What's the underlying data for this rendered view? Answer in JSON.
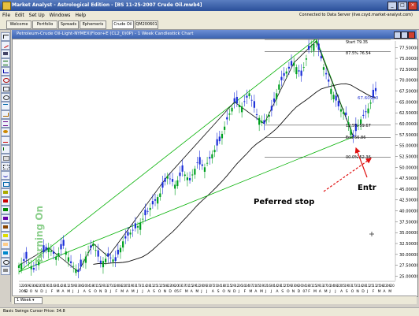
{
  "window": {
    "title": "Market Analyst - Astrological Edition - [BS 11-25-2007 Crude Oil.mwb4]"
  },
  "menu": [
    {
      "label": "File"
    },
    {
      "label": "Edit"
    },
    {
      "label": "Set Up"
    },
    {
      "label": "Windows"
    },
    {
      "label": "Help"
    }
  ],
  "connection": {
    "status": "Connected to Data Server (live.csyd.market-analyst.com)"
  },
  "tabs": [
    {
      "label": "Welcome"
    },
    {
      "label": "Portfolio"
    },
    {
      "label": "Spreads"
    },
    {
      "label": "Ephemeris"
    },
    {
      "label": "Crude Oil"
    },
    {
      "label": "QM200601"
    }
  ],
  "chart_window": {
    "title": "Petroleum-Crude Oil-Light-NYMEX(Floor+E (CL2_0)0P) - 1 Week Candlestick Chart"
  },
  "chart": {
    "annotations": {
      "side_label": "Turning On",
      "stop_label": "Peferred stop",
      "entry_label": "Entr",
      "last_price": "67.60900"
    },
    "fib_labels": {
      "start": "Start 79.35",
      "f875": "87.5% 76.54",
      "f125": "12.5% 59.67",
      "end": "End 56.86",
      "f00": "00.0% 52.36"
    },
    "colors": {
      "up": "#00a020",
      "down": "#1a2ed8",
      "fan": "#00b000",
      "stop": "#e01010"
    }
  },
  "chart_data": {
    "type": "candlestick",
    "y_ticks": [
      "77.50000",
      "75.00000",
      "72.50000",
      "70.00000",
      "67.50000",
      "65.00000",
      "62.50000",
      "60.00000",
      "57.50000",
      "55.00000",
      "52.50000",
      "50.00000",
      "47.50000",
      "45.00000",
      "42.50000",
      "40.00000",
      "37.50000",
      "35.00000",
      "32.50000",
      "30.00000",
      "27.50000",
      "25.00000"
    ],
    "y_values": [
      77.5,
      75,
      72.5,
      70,
      67.5,
      65,
      62.5,
      60,
      57.5,
      55,
      52.5,
      50,
      47.5,
      45,
      42.5,
      40,
      37.5,
      35,
      32.5,
      30,
      27.5,
      25
    ],
    "x_day_labels": [
      "12",
      "26",
      "09",
      "23",
      "08",
      "22",
      "05",
      "19",
      "02",
      "16",
      "30",
      "14",
      "28",
      "11",
      "25",
      "09",
      "23",
      "06",
      "20",
      "04",
      "18",
      "01",
      "15",
      "29",
      "13",
      "27",
      "10",
      "24",
      "08",
      "22",
      "05",
      "19",
      "03",
      "17",
      "31",
      "14",
      "28",
      "11",
      "25",
      "11",
      "25",
      "08",
      "22",
      "06",
      "20",
      "03",
      "17",
      "01",
      "15",
      "29",
      "12",
      "26",
      "09",
      "23",
      "07",
      "21",
      "04",
      "18",
      "01",
      "15",
      "29",
      "12",
      "26",
      "10",
      "24",
      "07",
      "21",
      "05",
      "19",
      "02",
      "16",
      "30",
      "14",
      "28",
      "11",
      "25",
      "09",
      "23",
      "06",
      "20",
      "04",
      "18",
      "01",
      "15",
      "29",
      "13",
      "27",
      "10",
      "24",
      "08",
      "22",
      "05",
      "19",
      "03",
      "17",
      "31",
      "14",
      "28",
      "11",
      "25",
      "11",
      "25",
      "08",
      "22",
      "06",
      "20"
    ],
    "x_month_labels": [
      "2002",
      "S",
      "O",
      "N",
      "D",
      "J",
      "F",
      "M",
      "A",
      "M",
      "J",
      "J",
      "A",
      "S",
      "O",
      "N",
      "D",
      "J",
      "F",
      "M",
      "A",
      "M",
      "J",
      "J",
      "A",
      "S",
      "O",
      "N",
      "D",
      "05",
      "F",
      "M",
      "A",
      "M",
      "J",
      "J",
      "A",
      "S",
      "O",
      "N",
      "D",
      "J",
      "F",
      "M",
      "A",
      "M",
      "J",
      "J",
      "A",
      "S",
      "O",
      "N",
      "D",
      "07",
      "F",
      "M",
      "A",
      "M",
      "J",
      "J",
      "A",
      "S",
      "O",
      "N",
      "D",
      "J",
      "F",
      "M",
      "A",
      "M"
    ],
    "ylim": [
      24,
      79
    ],
    "close_path": [
      [
        0,
        27.5
      ],
      [
        3,
        29
      ],
      [
        6,
        26.5
      ],
      [
        9,
        30
      ],
      [
        12,
        31.5
      ],
      [
        15,
        29.5
      ],
      [
        18,
        32
      ],
      [
        21,
        28
      ],
      [
        24,
        26
      ],
      [
        27,
        29.5
      ],
      [
        30,
        32.5
      ],
      [
        33,
        28
      ],
      [
        36,
        29.5
      ],
      [
        39,
        28.5
      ],
      [
        42,
        33
      ],
      [
        45,
        35
      ],
      [
        48,
        36.5
      ],
      [
        51,
        39
      ],
      [
        54,
        41.5
      ],
      [
        57,
        44
      ],
      [
        60,
        48
      ],
      [
        63,
        46
      ],
      [
        66,
        49
      ],
      [
        69,
        47
      ],
      [
        72,
        51
      ],
      [
        75,
        50
      ],
      [
        78,
        53
      ],
      [
        81,
        56
      ],
      [
        84,
        61
      ],
      [
        87,
        65
      ],
      [
        90,
        64
      ],
      [
        93,
        67
      ],
      [
        96,
        62
      ],
      [
        99,
        60
      ],
      [
        102,
        63
      ],
      [
        105,
        69
      ],
      [
        108,
        72
      ],
      [
        111,
        74
      ],
      [
        114,
        71
      ],
      [
        117,
        77
      ],
      [
        120,
        79
      ],
      [
        123,
        73
      ],
      [
        126,
        68
      ],
      [
        129,
        64
      ],
      [
        132,
        62
      ],
      [
        135,
        57
      ],
      [
        138,
        61
      ],
      [
        141,
        63.5
      ],
      [
        144,
        67.5
      ]
    ]
  }
}
